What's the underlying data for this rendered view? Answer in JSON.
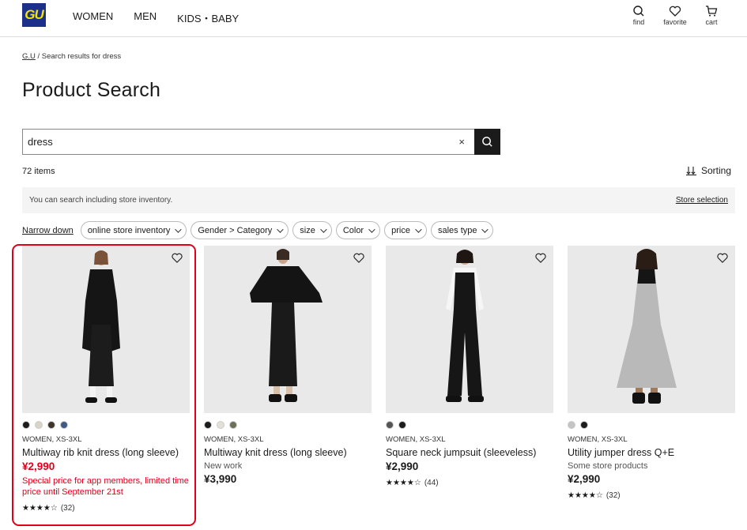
{
  "header": {
    "logo": "GU",
    "nav": [
      "WOMEN",
      "MEN",
      "KIDS・BABY"
    ],
    "icons": [
      {
        "name": "search-icon",
        "label": "find"
      },
      {
        "name": "heart-icon",
        "label": "favorite"
      },
      {
        "name": "cart-icon",
        "label": "cart"
      }
    ]
  },
  "breadcrumb": {
    "home": "G.U",
    "current": "/ Search results for dress"
  },
  "page_title": "Product Search",
  "search": {
    "value": "dress",
    "clear": "×"
  },
  "results": {
    "count": "72 items",
    "sorting": "Sorting"
  },
  "notice": {
    "text": "You can search including store inventory.",
    "link": "Store selection"
  },
  "filters": {
    "narrow_down": "Narrow down",
    "chips": [
      "online store inventory",
      "Gender > Category",
      "size",
      "Color",
      "price",
      "sales type"
    ]
  },
  "products": [
    {
      "colors": [
        "#1c1c1c",
        "#d9d3c8",
        "#3d342b",
        "#3f5a85"
      ],
      "meta": "WOMEN, XS-3XL",
      "name": "Multiway rib knit dress (long sleeve)",
      "sub": "",
      "price": "¥2,990",
      "promo": "Special price for app members, limited time price until September 21st",
      "stars": "★★★★☆",
      "rating_count": "(32)"
    },
    {
      "colors": [
        "#1c1c1c",
        "#e4e0d8",
        "#6d6f57"
      ],
      "meta": "WOMEN, XS-3XL",
      "name": "Multiway knit dress (long sleeve)",
      "sub": "New work",
      "price": "¥3,990",
      "promo": "",
      "stars": "",
      "rating_count": ""
    },
    {
      "colors": [
        "#555555",
        "#1c1c1c"
      ],
      "meta": "WOMEN, XS-3XL",
      "name": "Square neck jumpsuit (sleeveless)",
      "sub": "",
      "price": "¥2,990",
      "promo": "",
      "stars": "★★★★☆",
      "rating_count": "(44)"
    },
    {
      "colors": [
        "#c4c4c4",
        "#1c1c1c"
      ],
      "meta": "WOMEN, XS-3XL",
      "name": "Utility jumper dress Q+E",
      "sub": "Some store products",
      "price": "¥2,990",
      "promo": "",
      "stars": "★★★★☆",
      "rating_count": "(32)"
    }
  ]
}
